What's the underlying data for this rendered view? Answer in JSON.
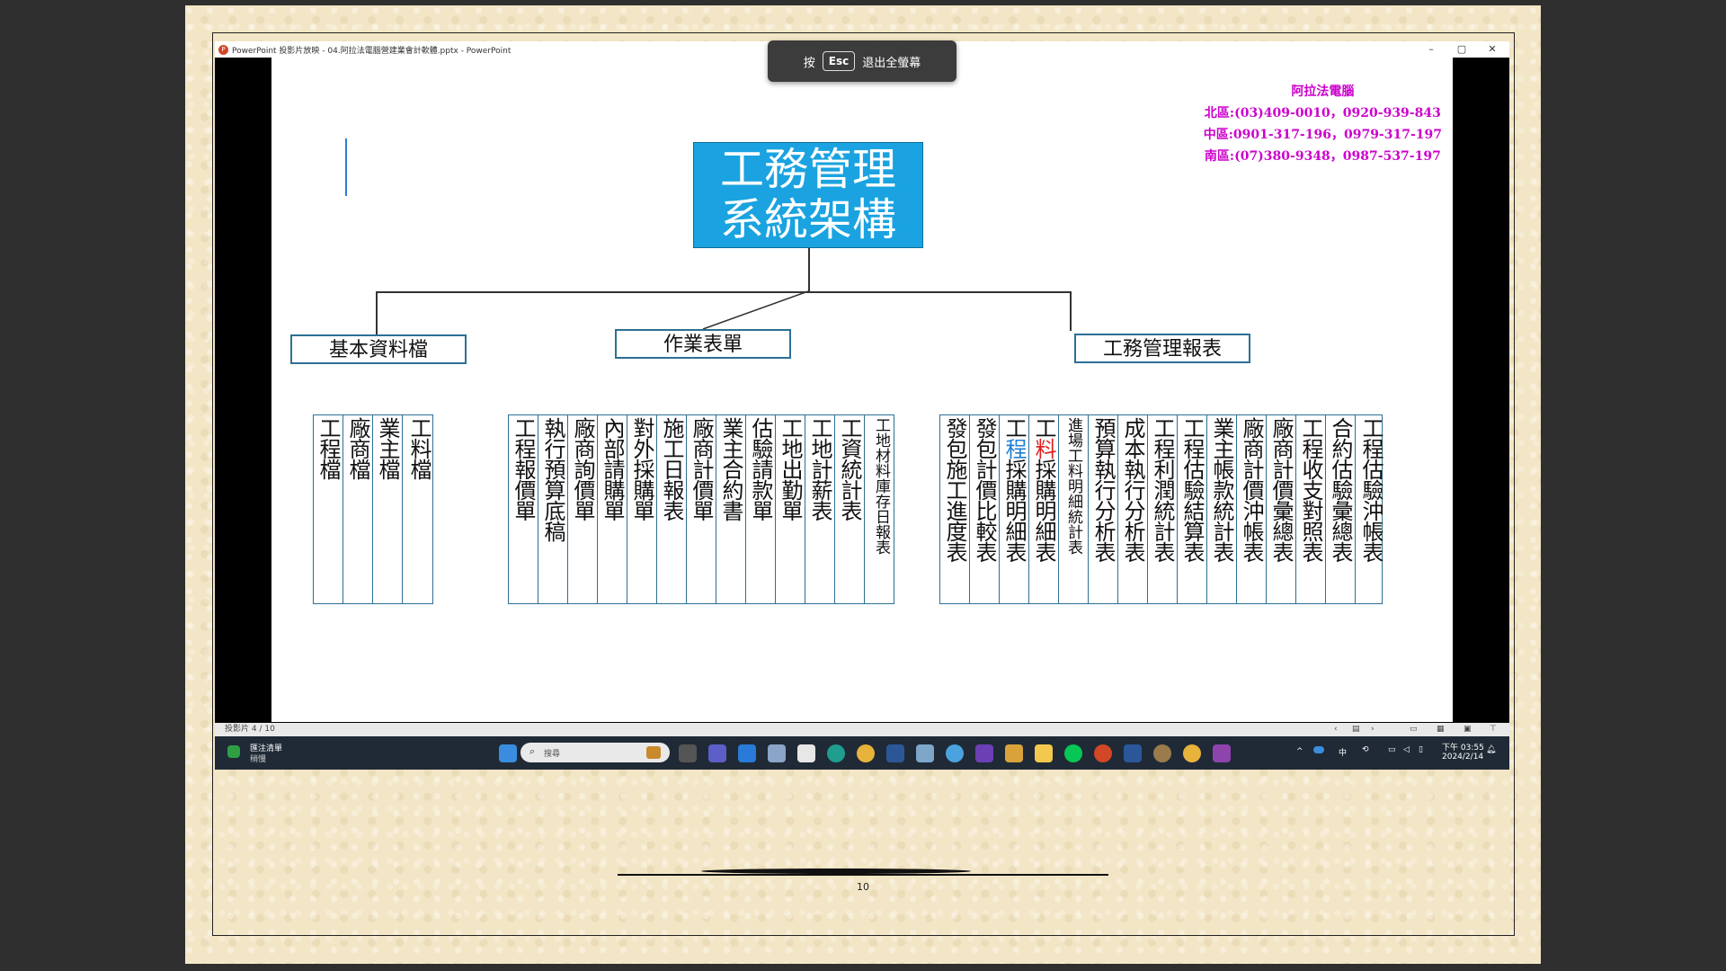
{
  "window": {
    "title": "PowerPoint 投影片放映 - 04.阿拉法電腦營建業會計軟體.pptx - PowerPoint",
    "controls": [
      "–",
      "▢",
      "✕"
    ]
  },
  "esc_banner": {
    "prefix": "按",
    "key": "Esc",
    "suffix": "退出全螢幕"
  },
  "contact": {
    "company": "阿拉法電腦",
    "lines": [
      "北區:(03)409-0010，0920-939-843",
      "中區:0901-317-196，0979-317-197",
      "南區:(07)380-9348，0987-537-197"
    ]
  },
  "chart": {
    "root": {
      "line1": "工務管理",
      "line2": "系統架構"
    },
    "categories": {
      "basic": "基本資料檔",
      "forms": "作業表單",
      "reports": "工務管理報表"
    },
    "basic_items": [
      "工程檔",
      "廠商檔",
      "業主檔",
      "工料檔"
    ],
    "form_items": [
      "工程報價單",
      "執行預算底稿",
      "廠商詢價單",
      "內部請購單",
      "對外採購單",
      "施工日報表",
      "廠商計價單",
      "業主合約書",
      "估驗請款單",
      "工地出勤單",
      "工地計薪表",
      "工資統計表",
      "工地材料庫存日報表"
    ],
    "report_items": [
      "發包施工進度表",
      "發包計價比較表",
      "工程採購明細表",
      "工料採購明細表",
      "進場工料明細統計表",
      "預算執行分析表",
      "成本執行分析表",
      "工程利潤統計表",
      "工程估驗結算表",
      "業主帳款統計表",
      "廠商計價沖帳表",
      "廠商計價彙總表",
      "工程收支對照表",
      "合約估驗彙總表",
      "工程估驗沖帳表"
    ]
  },
  "statusbar": {
    "slide_counter": "投影片 4 / 10"
  },
  "taskbar": {
    "widget_line1": "匯注清單",
    "widget_line2": "稍慢",
    "search_placeholder": "搜尋",
    "ime": "中",
    "time": "下午 03:55",
    "date": "2024/2/14"
  },
  "footer": {
    "page_number": "10"
  }
}
